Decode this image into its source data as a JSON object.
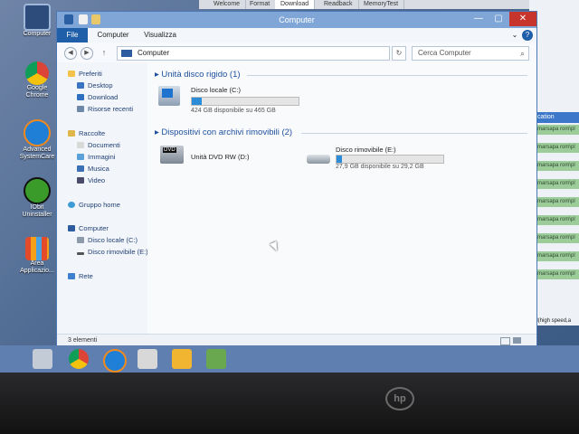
{
  "background_tabs": [
    "Welcome",
    "Format",
    "Download",
    "Readback",
    "MemoryTest"
  ],
  "background_rows": [
    "marsapa rom\\pl",
    "marsapa rom\\pl",
    "marsapa rom\\pl",
    "marsapa rom\\pl",
    "marsapa rom\\pl",
    "marsapa rom\\pl",
    "marsapa rom\\pl",
    "marsapa rom\\pl",
    "marsapa rom\\pl"
  ],
  "background_header": "cation",
  "background_footer": "ad All(high speed,a",
  "desktop_icons": [
    {
      "label": "Computer"
    },
    {
      "label": "Google Chrome"
    },
    {
      "label": "Advanced SystemCare"
    },
    {
      "label": "IObit Uninstaller"
    },
    {
      "label": "Area Applicazio..."
    }
  ],
  "window": {
    "title": "Computer",
    "controls": {
      "min": "—",
      "max": "▢",
      "close": "✕"
    }
  },
  "ribbon": {
    "file": "File",
    "tabs": [
      "Computer",
      "Visualizza"
    ],
    "expand": "⌄",
    "help": "?"
  },
  "address": {
    "back": "◀",
    "forward": "▶",
    "up": "↑",
    "path": "Computer",
    "refresh": "↻",
    "search_placeholder": "Cerca Computer",
    "search_icon": "⌕"
  },
  "nav": {
    "favorites": "Preferiti",
    "desktop": "Desktop",
    "download": "Download",
    "recent": "Risorse recenti",
    "libraries": "Raccolte",
    "documents": "Documenti",
    "images": "Immagini",
    "music": "Musica",
    "video": "Video",
    "homegroup": "Gruppo home",
    "computer": "Computer",
    "local_disk": "Disco locale (C:)",
    "removable_disk": "Disco rimovibile (E:)",
    "network": "Rete"
  },
  "groups": {
    "hard_disks": "Unità disco rigido (1)",
    "removable": "Dispositivi con archivi rimovibili (2)"
  },
  "drives": {
    "c": {
      "name": "Disco locale (C:)",
      "info": "424 GB disponibile su 465 GB",
      "used_fraction": 0.09
    },
    "dvd": {
      "name": "Unità DVD RW (D:)",
      "icon_text": "DVD"
    },
    "e": {
      "name": "Disco rimovibile (E:)",
      "info": "27,9 GB disponibile su 29,2 GB",
      "used_fraction": 0.05
    }
  },
  "status": "3 elementi",
  "colors": {
    "accent": "#1f5ea8",
    "drive_fill": "#2b8cd8"
  }
}
